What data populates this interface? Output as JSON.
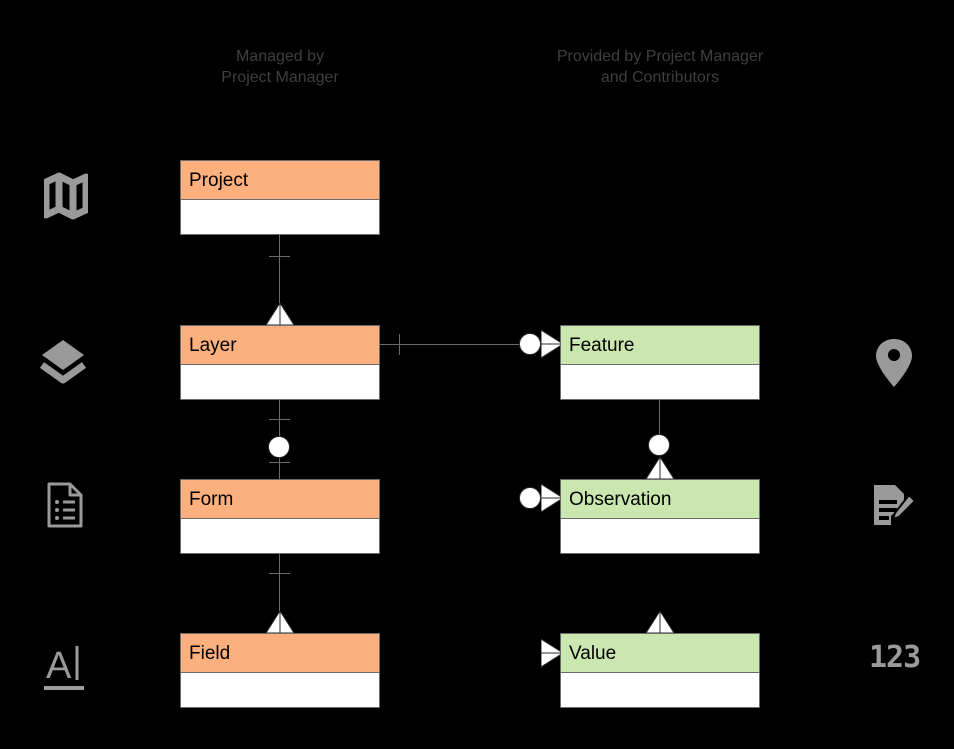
{
  "diagram": {
    "title": "Mapeo data model entity relationship diagram",
    "background_color": "#000000",
    "columns": [
      {
        "id": "managed",
        "label": "Managed by\nProject Manager",
        "color": "#fcb07e"
      },
      {
        "id": "provided",
        "label": "Provided by Project Manager\nand Contributors",
        "color": "#c9e7ae"
      }
    ],
    "entities": [
      {
        "id": "project",
        "label": "Project",
        "column": "managed",
        "color": "#fcb07e"
      },
      {
        "id": "layer",
        "label": "Layer",
        "column": "managed",
        "color": "#fcb07e"
      },
      {
        "id": "form",
        "label": "Form",
        "column": "managed",
        "color": "#fcb07e"
      },
      {
        "id": "field",
        "label": "Field",
        "column": "managed",
        "color": "#fcb07e"
      },
      {
        "id": "feature",
        "label": "Feature",
        "column": "provided",
        "color": "#c9e7ae"
      },
      {
        "id": "observation",
        "label": "Observation",
        "column": "provided",
        "color": "#c9e7ae"
      },
      {
        "id": "value",
        "label": "Value",
        "column": "provided",
        "color": "#c9e7ae"
      }
    ],
    "relationships": [
      {
        "from": "project",
        "to": "layer",
        "from_cardinality": "one",
        "to_cardinality": "many"
      },
      {
        "from": "layer",
        "to": "form",
        "from_cardinality": "one",
        "to_cardinality": "zero-or-one"
      },
      {
        "from": "form",
        "to": "field",
        "from_cardinality": "one",
        "to_cardinality": "many"
      },
      {
        "from": "layer",
        "to": "feature",
        "from_cardinality": "one",
        "to_cardinality": "zero-or-many"
      },
      {
        "from": "feature",
        "to": "observation",
        "from_cardinality": "zero",
        "to_cardinality": "many"
      },
      {
        "from": "observation",
        "to": "value",
        "from_cardinality": "many",
        "to_cardinality": "many"
      }
    ],
    "row_icons": [
      {
        "row": "project",
        "side": "left",
        "icon": "map-icon",
        "label": ""
      },
      {
        "row": "layer",
        "side": "left",
        "icon": "layers-icon",
        "label": ""
      },
      {
        "row": "form",
        "side": "left",
        "icon": "document-list-icon",
        "label": ""
      },
      {
        "row": "field",
        "side": "left",
        "icon": "text-cursor-icon",
        "label": "A|"
      },
      {
        "row": "feature",
        "side": "right",
        "icon": "map-pin-icon",
        "label": ""
      },
      {
        "row": "observation",
        "side": "right",
        "icon": "document-edit-icon",
        "label": ""
      },
      {
        "row": "value",
        "side": "right",
        "icon": "numbers-icon",
        "label": "123"
      }
    ]
  }
}
